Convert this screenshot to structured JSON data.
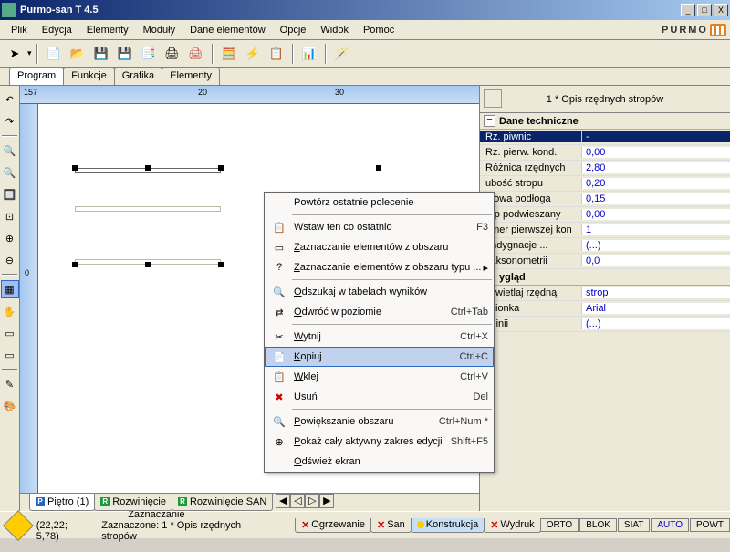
{
  "window": {
    "title": "Purmo-san T 4.5"
  },
  "menubar": [
    "Plik",
    "Edycja",
    "Elementy",
    "Moduły",
    "Dane elementów",
    "Opcje",
    "Widok",
    "Pomoc"
  ],
  "brand": "PURMO",
  "tabs_top": [
    "Program",
    "Funkcje",
    "Grafika",
    "Elementy"
  ],
  "tabs_top_active": 0,
  "ruler": {
    "v0": "157",
    "v1": "20",
    "v2": "30",
    "vl": "0"
  },
  "panel_title": "1 * Opis rzędnych stropów",
  "prop_sections": [
    {
      "title": "Dane techniczne",
      "rows": [
        {
          "label": "Rz. piwnic",
          "value": "-",
          "selected": true
        },
        {
          "label": "Rz. pierw. kond.",
          "value": "0,00"
        },
        {
          "label": "Różnica rzędnych",
          "value": "2,80"
        },
        {
          "label": "ubość stropu",
          "value": "0,20"
        },
        {
          "label": "otowa podłoga",
          "value": "0,15"
        },
        {
          "label": "rop podwieszany",
          "value": "0,00"
        },
        {
          "label": "umer pierwszej kon",
          "value": "1"
        },
        {
          "label": "ondygnacje ...",
          "value": "(...)"
        },
        {
          "label": "l aksonometrii",
          "value": "0,0"
        }
      ]
    },
    {
      "title": "ygląd",
      "rows": [
        {
          "label": "yświetlaj rzędną",
          "value": "strop"
        },
        {
          "label": "zcionka",
          "value": "Arial"
        },
        {
          "label": "p linii",
          "value": "(...)"
        }
      ]
    }
  ],
  "bottom_tabs": [
    {
      "icon": "P",
      "color": "#2266cc",
      "label": "Piętro (1)"
    },
    {
      "icon": "R",
      "color": "#1a9c3a",
      "label": "Rozwinięcie"
    },
    {
      "icon": "R",
      "color": "#1a9c3a",
      "label": "Rozwinięcie SAN"
    }
  ],
  "status_tabs": [
    {
      "x": true,
      "label": "Ogrzewanie"
    },
    {
      "x": true,
      "label": "San"
    },
    {
      "dot": "#ffcc00",
      "label": "Konstrukcja",
      "active": true
    },
    {
      "x": true,
      "label": "Wydruk"
    }
  ],
  "status": {
    "coords": "(22,22; 5,78)",
    "line1": "Zaznaczanie",
    "line2": "Zaznaczone: 1 * Opis rzędnych stropów"
  },
  "status_cells": [
    "ORTO",
    "BLOK",
    "SIAT",
    "AUTO",
    "POWT"
  ],
  "ctx": [
    {
      "t": "Powtórz ostatnie polecenie"
    },
    {
      "sep": 1
    },
    {
      "t": "Wstaw ten co ostatnio",
      "s": "F3",
      "i": "📋"
    },
    {
      "t": "Zaznaczanie elementów z obszaru",
      "i": "▭",
      "u": "Z"
    },
    {
      "t": "Zaznaczanie elementów z obszaru typu ...",
      "i": "?",
      "u": "Z",
      "arrow": 1
    },
    {
      "sep": 1
    },
    {
      "t": "Odszukaj w tabelach wyników",
      "i": "🔍",
      "u": "O"
    },
    {
      "t": "Odwróć w poziomie",
      "s": "Ctrl+Tab",
      "i": "⇄",
      "u": "O"
    },
    {
      "sep": 1
    },
    {
      "t": "Wytnij",
      "s": "Ctrl+X",
      "i": "✂",
      "u": "W"
    },
    {
      "t": "Kopiuj",
      "s": "Ctrl+C",
      "i": "📄",
      "hov": 1,
      "u": "K"
    },
    {
      "t": "Wklej",
      "s": "Ctrl+V",
      "i": "📋",
      "u": "W"
    },
    {
      "t": "Usuń",
      "s": "Del",
      "i": "✖",
      "u": "U",
      "red": 1
    },
    {
      "sep": 1
    },
    {
      "t": "Powiększanie obszaru",
      "s": "Ctrl+Num *",
      "i": "🔍",
      "u": "P"
    },
    {
      "t": "Pokaż cały aktywny zakres edycji",
      "s": "Shift+F5",
      "i": "⊕",
      "u": "P"
    },
    {
      "t": "Odśwież ekran",
      "u": "O"
    }
  ]
}
